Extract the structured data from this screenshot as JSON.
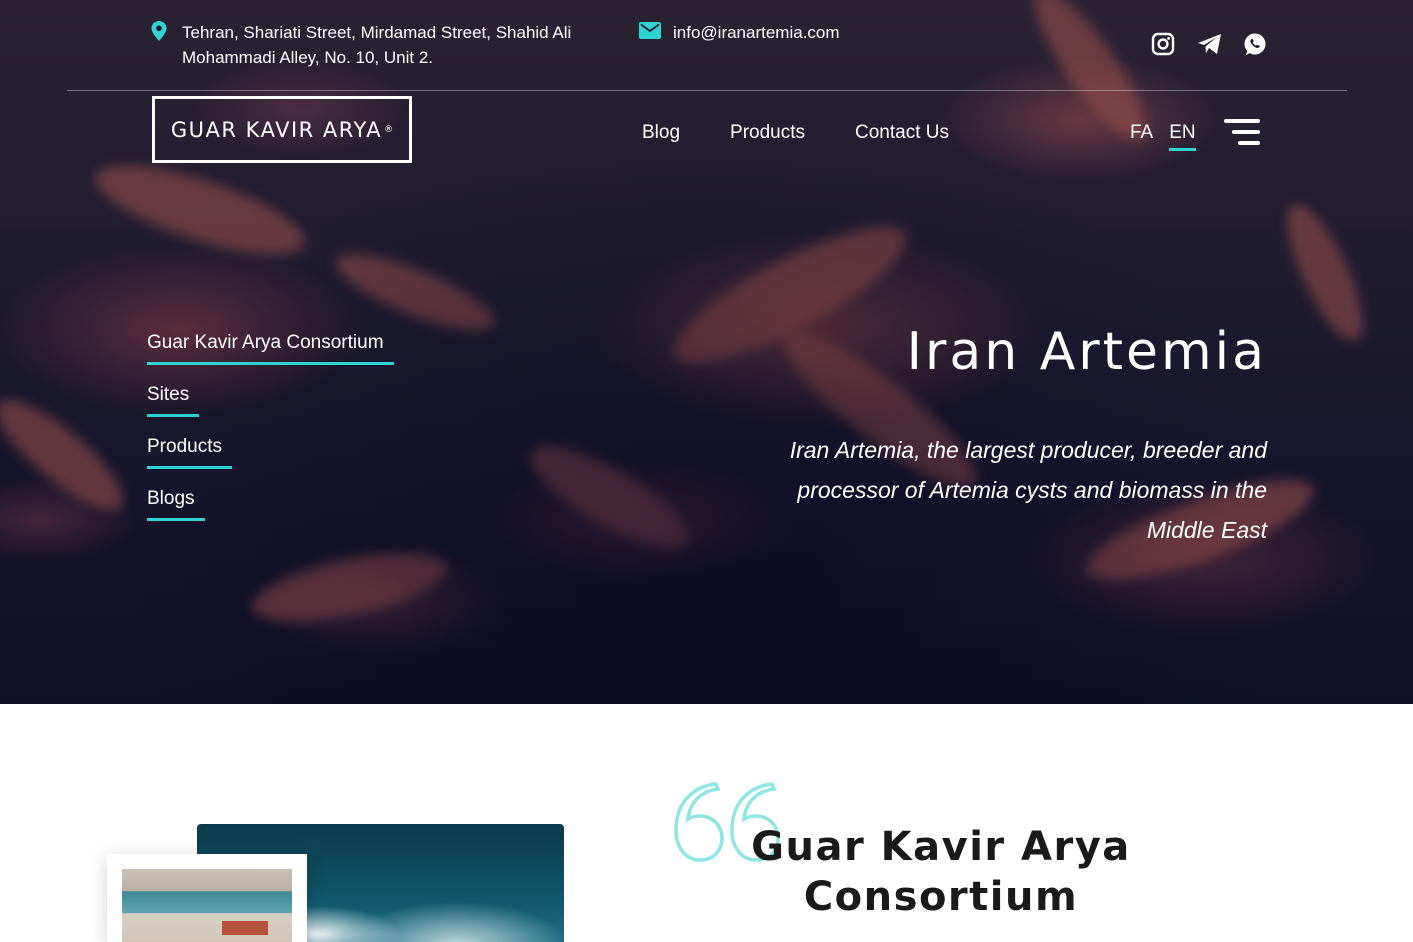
{
  "contact": {
    "address": "Tehran, Shariati Street, Mirdamad Street, Shahid Ali Mohammadi Alley, No. 10, Unit 2.",
    "email": "info@iranartemia.com"
  },
  "socials": [
    "instagram-icon",
    "telegram-icon",
    "whatsapp-icon"
  ],
  "logo": {
    "name": "GUAR KAVIR ARYA",
    "mark": "®"
  },
  "nav": {
    "items": [
      {
        "label": "Blog"
      },
      {
        "label": "Products"
      },
      {
        "label": "Contact Us"
      }
    ]
  },
  "language": {
    "options": [
      {
        "label": "FA"
      },
      {
        "label": "EN"
      }
    ],
    "selected": "EN"
  },
  "sidemenu": {
    "items": [
      {
        "label": "Guar Kavir Arya Consortium"
      },
      {
        "label": "Sites"
      },
      {
        "label": "Products"
      },
      {
        "label": "Blogs"
      }
    ]
  },
  "hero": {
    "title": "Iran Artemia",
    "subtitle": "Iran Artemia, the largest producer, breeder and processor of Artemia cysts and biomass in the Middle East"
  },
  "about": {
    "heading": "Guar Kavir Arya Consortium"
  },
  "colors": {
    "accent": "#2fd3d0",
    "hero_bg": "#14132a",
    "heading": "#1a1a1a"
  }
}
